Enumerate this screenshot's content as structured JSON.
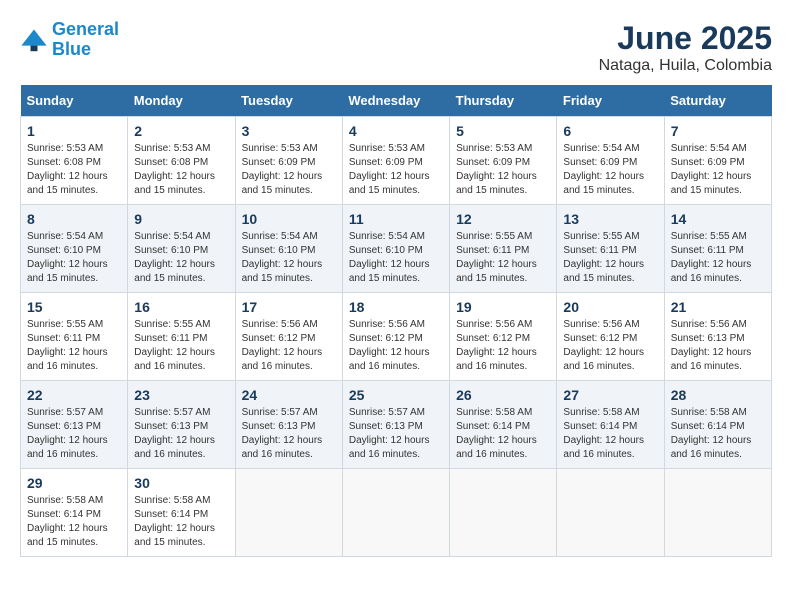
{
  "logo": {
    "line1": "General",
    "line2": "Blue"
  },
  "header": {
    "month": "June 2025",
    "location": "Nataga, Huila, Colombia"
  },
  "weekdays": [
    "Sunday",
    "Monday",
    "Tuesday",
    "Wednesday",
    "Thursday",
    "Friday",
    "Saturday"
  ],
  "weeks": [
    [
      {
        "day": "1",
        "sunrise": "5:53 AM",
        "sunset": "6:08 PM",
        "daylight": "12 hours and 15 minutes."
      },
      {
        "day": "2",
        "sunrise": "5:53 AM",
        "sunset": "6:08 PM",
        "daylight": "12 hours and 15 minutes."
      },
      {
        "day": "3",
        "sunrise": "5:53 AM",
        "sunset": "6:09 PM",
        "daylight": "12 hours and 15 minutes."
      },
      {
        "day": "4",
        "sunrise": "5:53 AM",
        "sunset": "6:09 PM",
        "daylight": "12 hours and 15 minutes."
      },
      {
        "day": "5",
        "sunrise": "5:53 AM",
        "sunset": "6:09 PM",
        "daylight": "12 hours and 15 minutes."
      },
      {
        "day": "6",
        "sunrise": "5:54 AM",
        "sunset": "6:09 PM",
        "daylight": "12 hours and 15 minutes."
      },
      {
        "day": "7",
        "sunrise": "5:54 AM",
        "sunset": "6:09 PM",
        "daylight": "12 hours and 15 minutes."
      }
    ],
    [
      {
        "day": "8",
        "sunrise": "5:54 AM",
        "sunset": "6:10 PM",
        "daylight": "12 hours and 15 minutes."
      },
      {
        "day": "9",
        "sunrise": "5:54 AM",
        "sunset": "6:10 PM",
        "daylight": "12 hours and 15 minutes."
      },
      {
        "day": "10",
        "sunrise": "5:54 AM",
        "sunset": "6:10 PM",
        "daylight": "12 hours and 15 minutes."
      },
      {
        "day": "11",
        "sunrise": "5:54 AM",
        "sunset": "6:10 PM",
        "daylight": "12 hours and 15 minutes."
      },
      {
        "day": "12",
        "sunrise": "5:55 AM",
        "sunset": "6:11 PM",
        "daylight": "12 hours and 15 minutes."
      },
      {
        "day": "13",
        "sunrise": "5:55 AM",
        "sunset": "6:11 PM",
        "daylight": "12 hours and 15 minutes."
      },
      {
        "day": "14",
        "sunrise": "5:55 AM",
        "sunset": "6:11 PM",
        "daylight": "12 hours and 16 minutes."
      }
    ],
    [
      {
        "day": "15",
        "sunrise": "5:55 AM",
        "sunset": "6:11 PM",
        "daylight": "12 hours and 16 minutes."
      },
      {
        "day": "16",
        "sunrise": "5:55 AM",
        "sunset": "6:11 PM",
        "daylight": "12 hours and 16 minutes."
      },
      {
        "day": "17",
        "sunrise": "5:56 AM",
        "sunset": "6:12 PM",
        "daylight": "12 hours and 16 minutes."
      },
      {
        "day": "18",
        "sunrise": "5:56 AM",
        "sunset": "6:12 PM",
        "daylight": "12 hours and 16 minutes."
      },
      {
        "day": "19",
        "sunrise": "5:56 AM",
        "sunset": "6:12 PM",
        "daylight": "12 hours and 16 minutes."
      },
      {
        "day": "20",
        "sunrise": "5:56 AM",
        "sunset": "6:12 PM",
        "daylight": "12 hours and 16 minutes."
      },
      {
        "day": "21",
        "sunrise": "5:56 AM",
        "sunset": "6:13 PM",
        "daylight": "12 hours and 16 minutes."
      }
    ],
    [
      {
        "day": "22",
        "sunrise": "5:57 AM",
        "sunset": "6:13 PM",
        "daylight": "12 hours and 16 minutes."
      },
      {
        "day": "23",
        "sunrise": "5:57 AM",
        "sunset": "6:13 PM",
        "daylight": "12 hours and 16 minutes."
      },
      {
        "day": "24",
        "sunrise": "5:57 AM",
        "sunset": "6:13 PM",
        "daylight": "12 hours and 16 minutes."
      },
      {
        "day": "25",
        "sunrise": "5:57 AM",
        "sunset": "6:13 PM",
        "daylight": "12 hours and 16 minutes."
      },
      {
        "day": "26",
        "sunrise": "5:58 AM",
        "sunset": "6:14 PM",
        "daylight": "12 hours and 16 minutes."
      },
      {
        "day": "27",
        "sunrise": "5:58 AM",
        "sunset": "6:14 PM",
        "daylight": "12 hours and 16 minutes."
      },
      {
        "day": "28",
        "sunrise": "5:58 AM",
        "sunset": "6:14 PM",
        "daylight": "12 hours and 16 minutes."
      }
    ],
    [
      {
        "day": "29",
        "sunrise": "5:58 AM",
        "sunset": "6:14 PM",
        "daylight": "12 hours and 15 minutes."
      },
      {
        "day": "30",
        "sunrise": "5:58 AM",
        "sunset": "6:14 PM",
        "daylight": "12 hours and 15 minutes."
      },
      null,
      null,
      null,
      null,
      null
    ]
  ],
  "labels": {
    "sunrise": "Sunrise:",
    "sunset": "Sunset:",
    "daylight": "Daylight:"
  }
}
